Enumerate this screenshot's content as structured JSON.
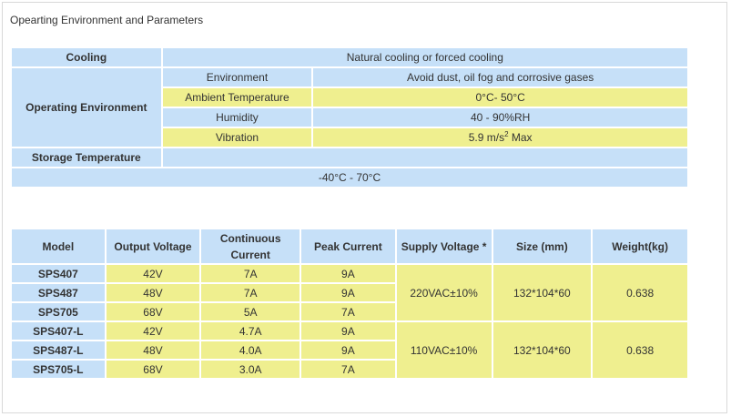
{
  "heading": "Opearting Environment and Parameters",
  "env": {
    "cooling_label": "Cooling",
    "cooling_value": "Natural cooling or forced cooling",
    "operating_label": "Operating Environment",
    "rows": [
      {
        "name": "Environment",
        "value": "Avoid dust, oil fog and corrosive gases"
      },
      {
        "name": "Ambient Temperature",
        "value": "0°C- 50°C"
      },
      {
        "name": "Humidity",
        "value": "40 - 90%RH"
      },
      {
        "name": "Vibration",
        "value": "5.9 m/s",
        "sup": "2",
        "value_suffix": " Max"
      }
    ],
    "storage_label": "Storage Temperature",
    "storage_value": "-40°C - 70°C"
  },
  "products": {
    "headers": [
      "Model",
      "Output Voltage",
      "Continuous Current",
      "Peak Current",
      "Supply Voltage *",
      "Size (mm)",
      "Weight(kg)"
    ],
    "rows": [
      {
        "model": "SPS407",
        "output": "42V",
        "continuous": "7A",
        "peak": "9A"
      },
      {
        "model": "SPS487",
        "output": "48V",
        "continuous": "7A",
        "peak": "9A"
      },
      {
        "model": "SPS705",
        "output": "68V",
        "continuous": "5A",
        "peak": "7A"
      },
      {
        "model": "SPS407-L",
        "output": "42V",
        "continuous": "4.7A",
        "peak": "9A"
      },
      {
        "model": "SPS487-L",
        "output": "48V",
        "continuous": "4.0A",
        "peak": "9A"
      },
      {
        "model": "SPS705-L",
        "output": "68V",
        "continuous": "3.0A",
        "peak": "7A"
      }
    ],
    "groups": [
      {
        "supply": "220VAC±10%",
        "size": "132*104*60",
        "weight": "0.638"
      },
      {
        "supply": "110VAC±10%",
        "size": "132*104*60",
        "weight": "0.638"
      }
    ]
  }
}
